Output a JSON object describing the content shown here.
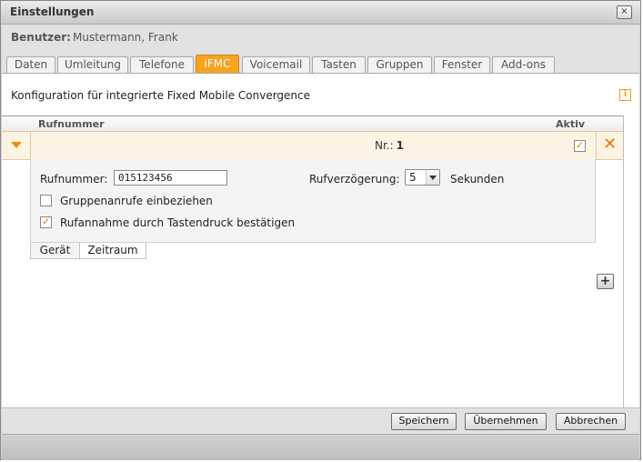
{
  "window": {
    "title": "Einstellungen",
    "close_label": "×"
  },
  "user": {
    "label": "Benutzer:",
    "name": "Mustermann, Frank"
  },
  "tabs": [
    "Daten",
    "Umleitung",
    "Telefone",
    "iFMC",
    "Voicemail",
    "Tasten",
    "Gruppen",
    "Fenster",
    "Add-ons"
  ],
  "active_tab": "iFMC",
  "config": {
    "title": "Konfiguration für integrierte Fixed Mobile Convergence",
    "info_icon": "i"
  },
  "table": {
    "col_number": "Rufnummer",
    "col_active": "Aktiv",
    "row": {
      "nr_label": "Nr.:",
      "nr_value": "1",
      "active": true,
      "delete_icon": "✕"
    }
  },
  "detail": {
    "number_label": "Rufnummer:",
    "number_value": "015123456",
    "delay_label": "Rufverzögerung:",
    "delay_value": "5",
    "delay_unit": "Sekunden",
    "group_calls_label": "Gruppenanrufe einbeziehen",
    "group_calls_checked": false,
    "confirm_label": "Rufannahme durch Tastendruck bestätigen",
    "confirm_checked": true
  },
  "subtabs": [
    "Gerät",
    "Zeitraum"
  ],
  "add_button": "+",
  "buttons": {
    "save": "Speichern",
    "apply": "Übernehmen",
    "cancel": "Abbrechen"
  },
  "colors": {
    "accent": "#f7a31e",
    "row_bg": "#fdf3e2"
  }
}
